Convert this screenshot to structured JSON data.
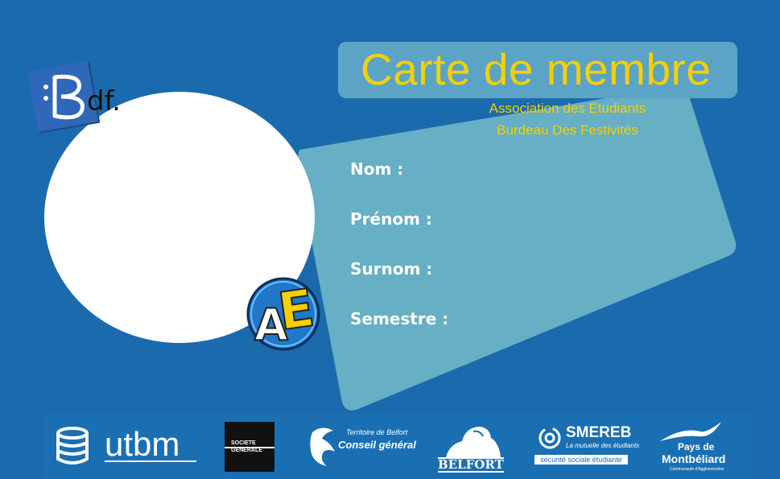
{
  "card": {
    "title": "Carte de membre",
    "subtitle_line1": "Association des Etudiants",
    "subtitle_line2": "Burdeau Des Festivités"
  },
  "logos": {
    "bdf_text": "df.",
    "bdf_letter": "B",
    "ae_letter_a": "A",
    "ae_letter_e": "E"
  },
  "fields": [
    {
      "label": "Nom :"
    },
    {
      "label": "Prénom :"
    },
    {
      "label": "Surnom :"
    },
    {
      "label": "Semestre :"
    }
  ],
  "sponsors": {
    "utbm": "utbm",
    "sg_line1": "SOCIETE",
    "sg_line2": "GENERALE",
    "tdb_line1": "Territoire de Belfort",
    "tdb_line2": "Conseil général",
    "belfort": "BELFORT",
    "smereb_name": "SMEREB",
    "smereb_tagline": "La mutuelle des étudiants",
    "smereb_sub": "sécurité sociale étudiante",
    "pm_line1": "Pays de",
    "pm_line2": "Montbéliard",
    "pm_line3": "Communauté d'Agglomération"
  },
  "colors": {
    "background": "#1b6aae",
    "panel": "#66afc4",
    "title": "#f5d000"
  }
}
